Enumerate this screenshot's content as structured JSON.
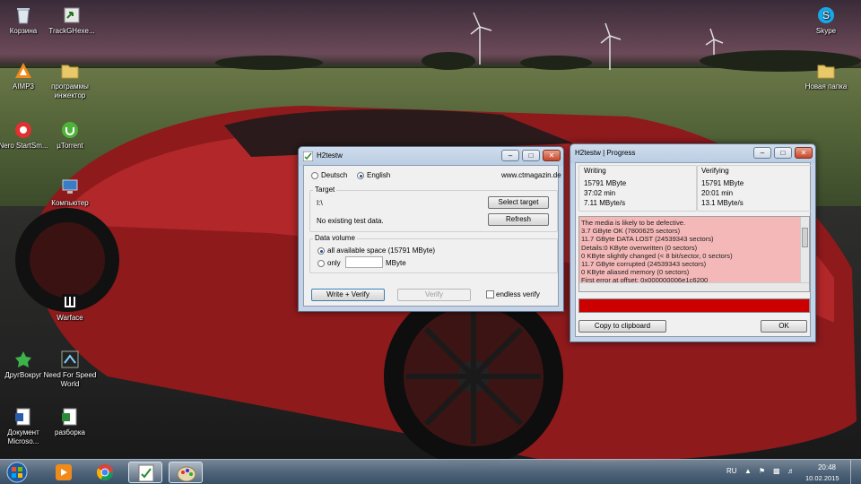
{
  "desktop": {
    "icons": [
      {
        "label": "Корзина",
        "icon": "recycle-bin-icon"
      },
      {
        "label": "TrackGHexe...",
        "icon": "shortcut-icon"
      },
      {
        "label": "AIMP3",
        "icon": "aimp-icon"
      },
      {
        "label": "программы инжектор",
        "icon": "folder-icon"
      },
      {
        "label": "Nero StartSm...",
        "icon": "nero-icon"
      },
      {
        "label": "µTorrent",
        "icon": "utorrent-icon"
      },
      {
        "label": "Компьютер",
        "icon": "computer-icon"
      },
      {
        "label": "Warface",
        "icon": "warface-icon"
      },
      {
        "label": "ДругВокруг",
        "icon": "drugvokrug-icon"
      },
      {
        "label": "Need For Speed World",
        "icon": "nfs-icon"
      },
      {
        "label": "Документ Microso...",
        "icon": "word-document-icon"
      },
      {
        "label": "разборка",
        "icon": "excel-document-icon"
      },
      {
        "label": "Skype",
        "icon": "skype-icon"
      },
      {
        "label": "Новая папка",
        "icon": "folder-icon"
      }
    ]
  },
  "h2testw": {
    "title": "H2testw",
    "lang_deutsch": "Deutsch",
    "lang_english": "English",
    "website": "www.ctmagazin.de",
    "target_label": "Target",
    "target_value": "I:\\",
    "select_target": "Select target",
    "no_data": "No existing test data.",
    "refresh": "Refresh",
    "volume_label": "Data volume",
    "all_space": "all available space (15791 MByte)",
    "only": "only",
    "mbyte": "MByte",
    "write_verify": "Write + Verify",
    "verify": "Verify",
    "endless": "endless verify"
  },
  "progress": {
    "title": "H2testw | Progress",
    "writing_label": "Writing",
    "writing": [
      "15791 MByte",
      "37:02 min",
      "7.11 MByte/s"
    ],
    "verifying_label": "Verifying",
    "verifying": [
      "15791 MByte",
      "20:01 min",
      "13.1 MByte/s"
    ],
    "result_lines": [
      "The media is likely to be defective.",
      "3.7 GByte OK (7800625 sectors)",
      "11.7 GByte DATA LOST (24539343 sectors)",
      "Details:0 KByte overwritten (0 sectors)",
      "0 KByte slightly changed (< 8 bit/sector, 0 sectors)",
      "11.7 GByte corrupted (24539343 sectors)",
      "0 KByte aliased memory (0 sectors)",
      "First error at offset: 0x000000006e1c6200"
    ],
    "copy": "Copy to clipboard",
    "ok": "OK",
    "bar_fill": 1.0,
    "bar_color": "#cc0000",
    "result_bg": "#f4b8b8"
  },
  "taskbar": {
    "lang": "RU",
    "time": "20:48",
    "date": "10.02.2015",
    "apps": [
      "start-orb-icon",
      "media-player-icon",
      "chrome-icon",
      "h2testw-icon",
      "paint-icon"
    ]
  }
}
